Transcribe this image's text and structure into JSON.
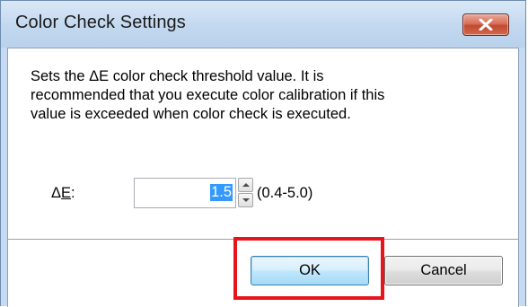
{
  "window": {
    "title": "Color Check Settings",
    "close_icon": "close-icon"
  },
  "content": {
    "description": "Sets the ΔE color check threshold value. It is\nrecommended that you execute color calibration if this\nvalue is exceeded when color check is executed.",
    "delta_e_label_prefix": "Δ",
    "delta_e_label_underlined": "E",
    "delta_e_label_suffix": ":",
    "delta_e_value": "1.5",
    "range_text": "(0.4-5.0)"
  },
  "buttons": {
    "ok_label": "OK",
    "cancel_label": "Cancel"
  },
  "colors": {
    "highlight": "#e8141b",
    "close_button": "#c24a30",
    "selection": "#3399ff"
  }
}
